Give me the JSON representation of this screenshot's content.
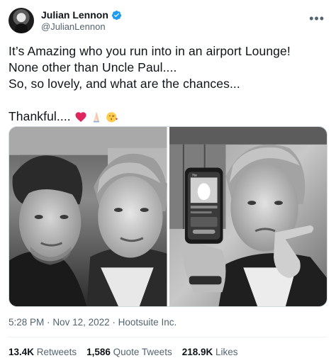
{
  "author": {
    "display_name": "Julian Lennon",
    "handle": "@JulianLennon",
    "verified": true
  },
  "tweet": {
    "lines": [
      "It’s Amazing who you run into in an airport Lounge!",
      "None other than Uncle Paul....",
      "So, so lovely, and what are the chances..."
    ],
    "closing": "Thankful....",
    "emojis": [
      "red-heart-emoji",
      "folded-hands-emoji",
      "face-blowing-kiss-emoji"
    ]
  },
  "media": {
    "photo_count": 2,
    "phone_screen_text": "7to"
  },
  "meta": {
    "time": "5:28 PM",
    "separator": "·",
    "date": "Nov 12, 2022",
    "source": "Hootsuite Inc."
  },
  "stats": {
    "retweets_count": "13.4K",
    "retweets_label": "Retweets",
    "quotes_count": "1,586",
    "quotes_label": "Quote Tweets",
    "likes_count": "218.9K",
    "likes_label": "Likes"
  },
  "colors": {
    "text_primary": "#0f1419",
    "text_secondary": "#536471",
    "verified_blue": "#1d9bf0",
    "heart_red": "#e0245e"
  },
  "icons": {
    "more": "more-horizontal-icon",
    "verified": "verified-badge-icon"
  }
}
